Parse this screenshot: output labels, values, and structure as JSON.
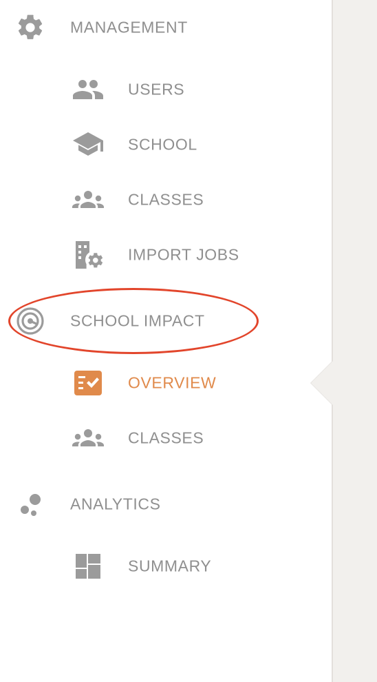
{
  "sidebar": {
    "management": {
      "label": "MANAGEMENT",
      "icon": "gear-icon"
    },
    "users": {
      "label": "USERS",
      "icon": "users-icon"
    },
    "school": {
      "label": "SCHOOL",
      "icon": "graduation-cap-icon"
    },
    "classes_mgmt": {
      "label": "CLASSES",
      "icon": "group-icon"
    },
    "import_jobs": {
      "label": "IMPORT JOBS",
      "icon": "building-gear-icon"
    },
    "school_impact": {
      "label": "SCHOOL IMPACT",
      "icon": "target-icon"
    },
    "overview": {
      "label": "OVERVIEW",
      "icon": "checklist-icon",
      "active": true
    },
    "classes_impact": {
      "label": "CLASSES",
      "icon": "group-icon"
    },
    "analytics": {
      "label": "ANALYTICS",
      "icon": "bubbles-icon"
    },
    "summary": {
      "label": "SUMMARY",
      "icon": "dashboard-icon"
    }
  },
  "colors": {
    "text": "#8f8f8f",
    "icon": "#9b9b9b",
    "active": "#e08a4b",
    "highlight": "#e2452b",
    "background": "#f2f0ed"
  }
}
